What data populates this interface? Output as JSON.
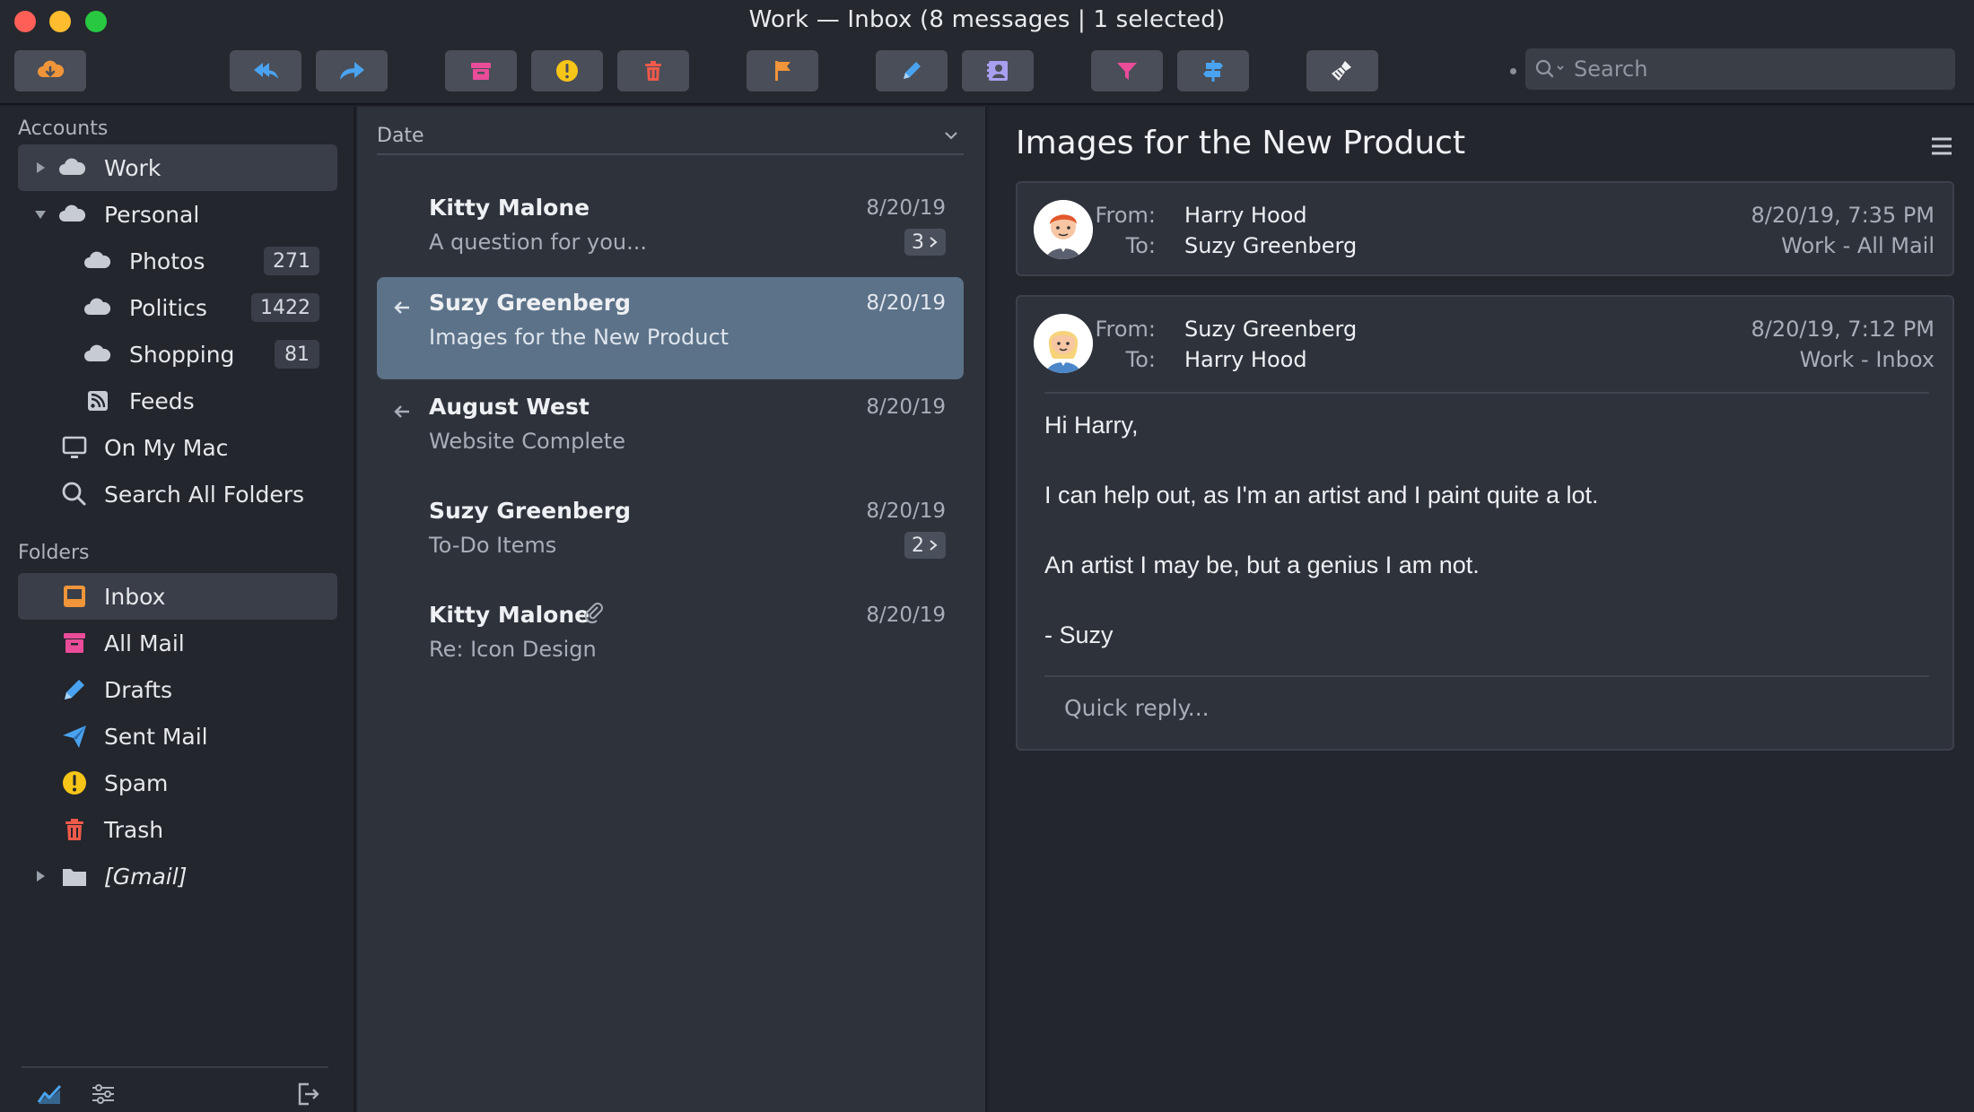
{
  "window": {
    "title": "Work — Inbox (8 messages | 1 selected)"
  },
  "toolbar": {
    "buttons": [
      {
        "name": "get-mail",
        "icon": "cloud-download-icon"
      },
      {
        "name": "reply-all",
        "icon": "reply-all-icon"
      },
      {
        "name": "forward",
        "icon": "forward-icon"
      },
      {
        "name": "archive",
        "icon": "archive-icon"
      },
      {
        "name": "spam",
        "icon": "spam-icon"
      },
      {
        "name": "delete",
        "icon": "trash-icon"
      },
      {
        "name": "flag",
        "icon": "flag-icon"
      },
      {
        "name": "compose",
        "icon": "pencil-icon"
      },
      {
        "name": "contacts",
        "icon": "contacts-icon"
      },
      {
        "name": "filter",
        "icon": "funnel-icon"
      },
      {
        "name": "rules",
        "icon": "signpost-icon"
      },
      {
        "name": "cleanup",
        "icon": "broom-icon"
      }
    ],
    "search_placeholder": "Search"
  },
  "sidebar": {
    "accounts_label": "Accounts",
    "accounts": [
      {
        "label": "Work",
        "selected": true
      },
      {
        "label": "Personal"
      },
      {
        "label": "Photos",
        "count": "271"
      },
      {
        "label": "Politics",
        "count": "1422"
      },
      {
        "label": "Shopping",
        "count": "81"
      },
      {
        "label": "Feeds"
      },
      {
        "label": "On My Mac"
      },
      {
        "label": "Search All Folders"
      }
    ],
    "folders_label": "Folders",
    "folders": [
      {
        "label": "Inbox",
        "selected": true
      },
      {
        "label": "All Mail"
      },
      {
        "label": "Drafts"
      },
      {
        "label": "Sent Mail"
      },
      {
        "label": "Spam"
      },
      {
        "label": "Trash"
      },
      {
        "label": "[Gmail]"
      }
    ]
  },
  "list": {
    "sort_label": "Date",
    "messages": [
      {
        "sender": "Kitty Malone",
        "subject": "A question for you...",
        "date": "8/20/19",
        "thread": "3"
      },
      {
        "sender": "Suzy Greenberg",
        "subject": "Images for the New Product",
        "date": "8/20/19",
        "replied": true,
        "selected": true
      },
      {
        "sender": "August West",
        "subject": "Website Complete",
        "date": "8/20/19",
        "replied": true
      },
      {
        "sender": "Suzy Greenberg",
        "subject": "To-Do Items",
        "date": "8/20/19",
        "thread": "2"
      },
      {
        "sender": "Kitty Malone",
        "subject": "Re: Icon Design",
        "date": "8/20/19",
        "attachment": true
      }
    ]
  },
  "reader": {
    "title": "Images for the New Product",
    "from_label": "From:",
    "to_label": "To:",
    "messages": [
      {
        "from": "Harry Hood",
        "to": "Suzy Greenberg",
        "date": "8/20/19, 7:35 PM",
        "mailbox": "Work - All Mail"
      },
      {
        "from": "Suzy Greenberg",
        "to": "Harry Hood",
        "date": "8/20/19, 7:12 PM",
        "mailbox": "Work - Inbox",
        "body": [
          "Hi Harry,",
          "I can help out, as I'm an artist and I paint quite a lot.",
          "An artist I may be, but a genius I am not.",
          "- Suzy"
        ]
      }
    ],
    "quick_reply_placeholder": "Quick reply..."
  },
  "colors": {
    "accent_orange": "#f0953a",
    "accent_blue": "#4aa3f0",
    "accent_pink": "#ea4c9a",
    "accent_yellow": "#f5c518",
    "accent_red": "#ef5a4a",
    "selected_row": "#5c7289"
  }
}
